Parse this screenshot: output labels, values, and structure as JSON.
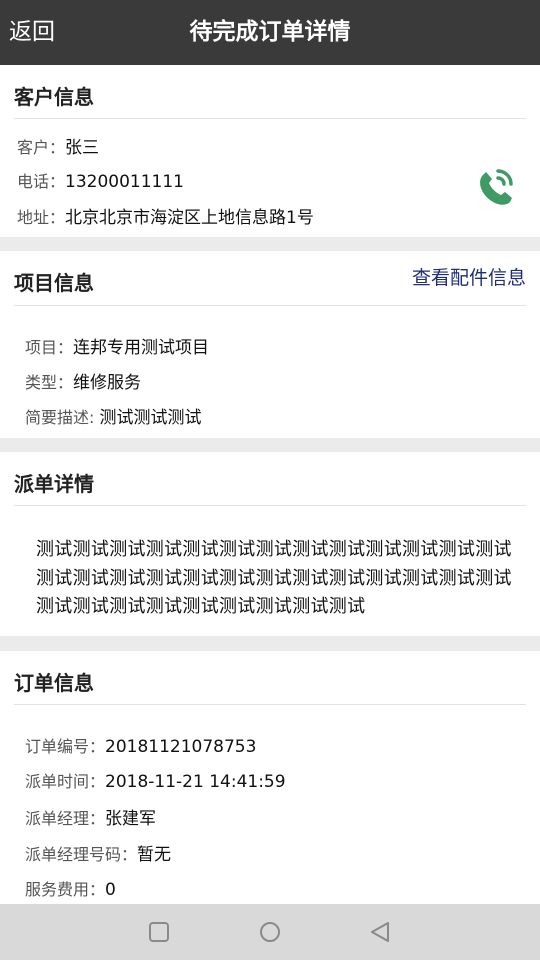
{
  "header": {
    "back_label": "返回",
    "title": "待完成订单详情"
  },
  "customer": {
    "title": "客户信息",
    "rows": [
      {
        "label": "客户：",
        "value": "张三"
      },
      {
        "label": "电话：",
        "value": "13200011111"
      },
      {
        "label": "地址：",
        "value": "北京北京市海淀区上地信息路1号"
      }
    ]
  },
  "project": {
    "title": "项目信息",
    "link_label": "查看配件信息",
    "rows": [
      {
        "label": "项目：",
        "value": "连邦专用测试项目"
      },
      {
        "label": "类型：",
        "value": "维修服务"
      },
      {
        "label": "简要描述: ",
        "value": "测试测试测试"
      }
    ]
  },
  "dispatch": {
    "title": "派单详情",
    "text": "测试测试测试测试测试测试测试测试测试测试测试测试测试测试测试测试测试测试测试测试测试测试测试测试测试测试测试测试测试测试测试测试测试测试测试"
  },
  "order": {
    "title": "订单信息",
    "rows": [
      {
        "label": "订单编号：",
        "value": "20181121078753"
      },
      {
        "label": "派单时间：",
        "value": "2018-11-21 14:41:59"
      },
      {
        "label": "派单经理：",
        "value": "张建军"
      },
      {
        "label": "派单经理号码：",
        "value": "暂无"
      },
      {
        "label": "服务费用：",
        "value": "0"
      }
    ]
  },
  "icons": {
    "phone": "phone-call-icon",
    "accent_color": "#3f9a64"
  },
  "system_nav": {
    "square": "recent-apps-icon",
    "circle": "home-icon",
    "triangle": "back-triangle-icon"
  }
}
